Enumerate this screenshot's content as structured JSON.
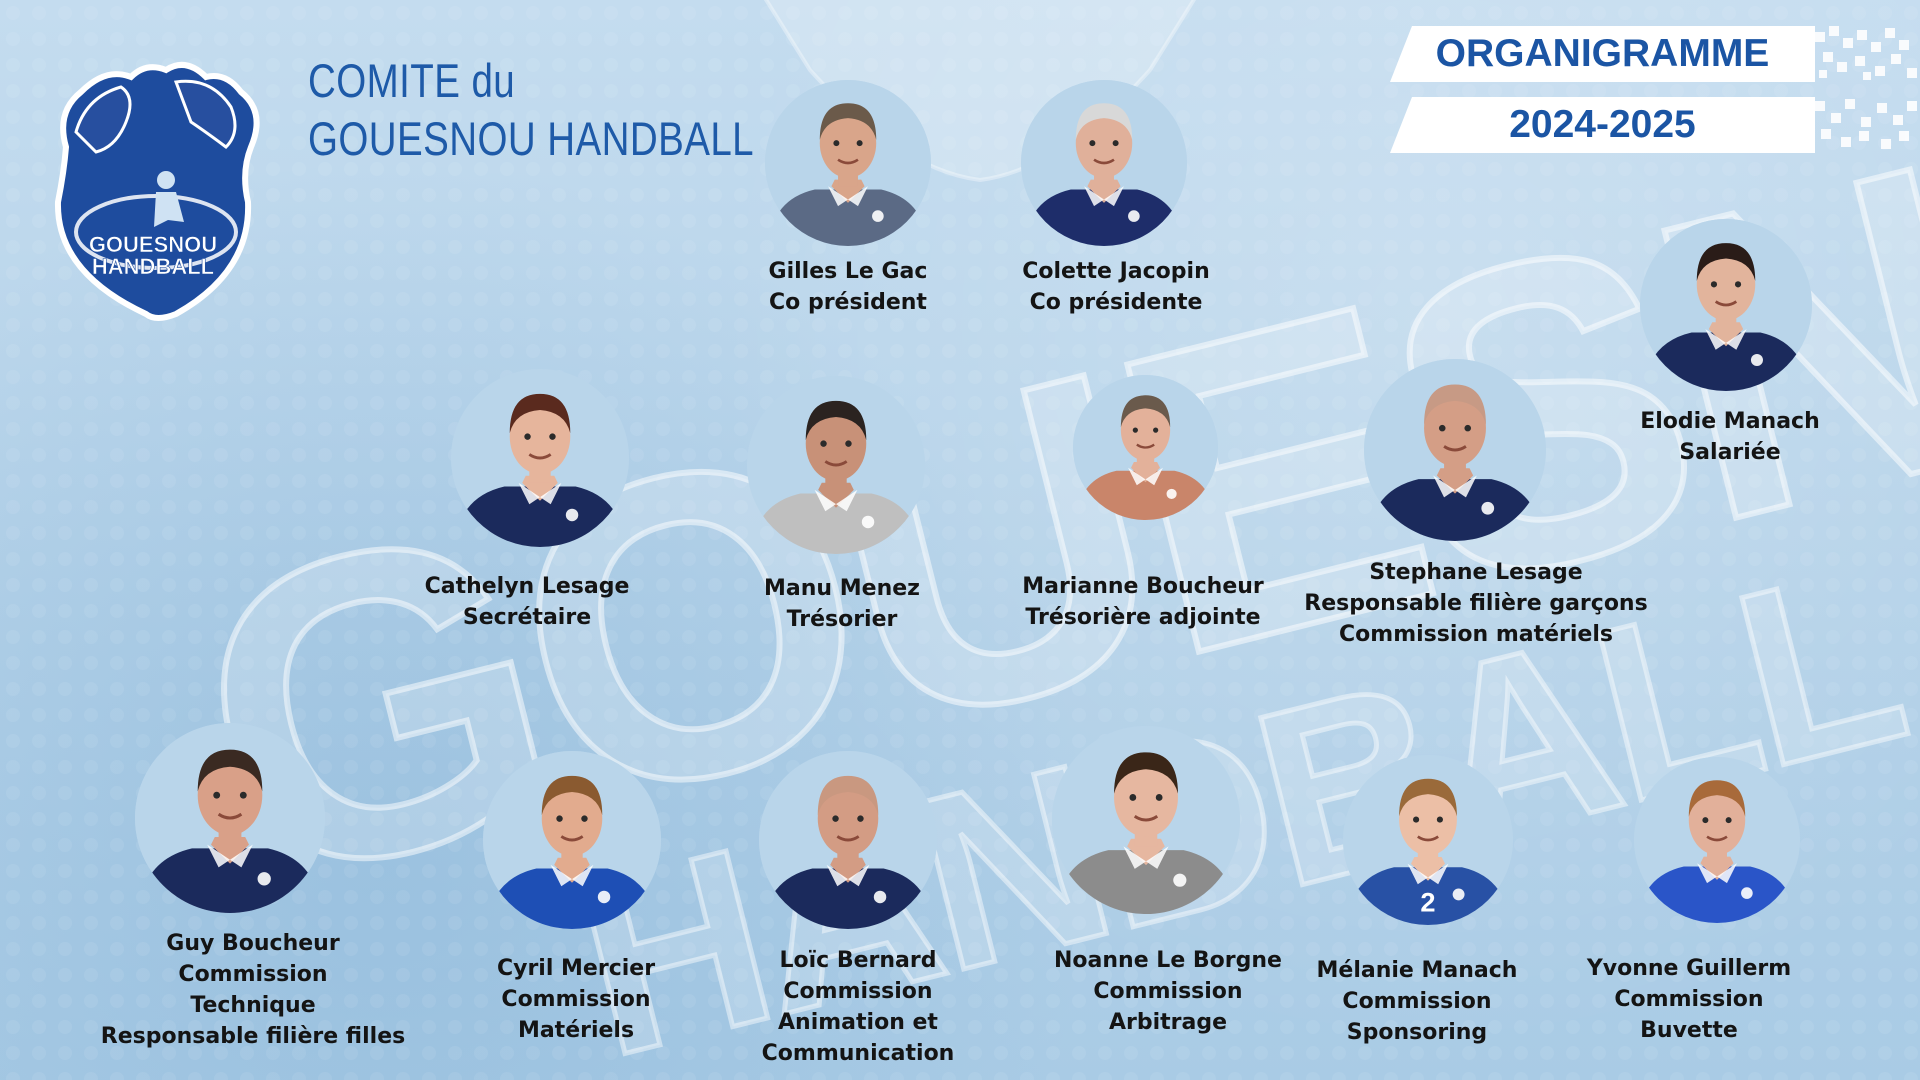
{
  "header": {
    "club_title_line1": "COMITE du",
    "club_title_line2": "GOUESNOU HANDBALL",
    "banner_title": "ORGANIGRAMME",
    "banner_season": "2024-2025"
  },
  "logo": {
    "icon": "horse-shield-logo-icon",
    "line1": "GOUESNOU",
    "line2": "HANDBALL"
  },
  "background": {
    "watermark_line1": "GOUESNOU",
    "watermark_line2": "HANDBALL"
  },
  "colors": {
    "background": "#b9d5ea",
    "brand_blue": "#1e5aa8",
    "navy": "#1c2a5c",
    "text": "#141414"
  },
  "members": [
    {
      "name": "Gilles Le Gac",
      "roles": [
        "Co président"
      ],
      "shirt": "#5b6a85",
      "hair": "#6b5a4a",
      "skin": "#d9a58a"
    },
    {
      "name": "Colette Jacopin",
      "roles": [
        "Co présidente"
      ],
      "shirt": "#1e2d6a",
      "hair": "#d8d8d8",
      "skin": "#e0b09a"
    },
    {
      "name": "Elodie Manach",
      "roles": [
        "Salariée"
      ],
      "shirt": "#1b2a5c",
      "hair": "#2a1c18",
      "skin": "#e2b49c"
    },
    {
      "name": "Cathelyn Lesage",
      "roles": [
        "Secrétaire"
      ],
      "shirt": "#1b2a5c",
      "hair": "#5a2a1e",
      "skin": "#e6b59c"
    },
    {
      "name": "Manu Menez",
      "roles": [
        "Trésorier"
      ],
      "shirt": "#bfbfbf",
      "hair": "#2b2320",
      "skin": "#c89178"
    },
    {
      "name": "Marianne Boucheur",
      "roles": [
        "Trésorière adjointe"
      ],
      "shirt": "#c9856a",
      "hair": "#6a5a4c",
      "skin": "#e3b19a"
    },
    {
      "name": "Stephane Lesage",
      "roles": [
        "Responsable filière garçons",
        "Commission matériels"
      ],
      "shirt": "#1b2a5c",
      "hair": "#c79a85",
      "skin": "#d49e86"
    },
    {
      "name": "Guy Boucheur",
      "roles": [
        "Commission",
        "Technique",
        "Responsable filière filles"
      ],
      "shirt": "#1b2a5c",
      "hair": "#3a2a22",
      "skin": "#d9a088"
    },
    {
      "name": "Cyril Mercier",
      "roles": [
        "Commission",
        "Matériels"
      ],
      "shirt": "#1e4fb5",
      "hair": "#8a5a30",
      "skin": "#e2ab8e"
    },
    {
      "name": "Loïc Bernard",
      "roles": [
        "Commission",
        "Animation et",
        "Communication"
      ],
      "shirt": "#1b2a5c",
      "hair": "#c99880",
      "skin": "#d39c84"
    },
    {
      "name": "Noanne Le Borgne",
      "roles": [
        "Commission",
        "Arbitrage"
      ],
      "shirt": "#8c8c8c",
      "hair": "#3a2618",
      "skin": "#e6b7a0"
    },
    {
      "name": "Mélanie Manach",
      "roles": [
        "Commission",
        "Sponsoring"
      ],
      "shirt": "#2851a5",
      "hair": "#9a6a3a",
      "skin": "#ecbfa6",
      "jersey_number": "2"
    },
    {
      "name": "Yvonne Guillerm",
      "roles": [
        "Commission",
        "Buvette"
      ],
      "shirt": "#2a55c8",
      "hair": "#a86a3a",
      "skin": "#e2b09a"
    }
  ]
}
